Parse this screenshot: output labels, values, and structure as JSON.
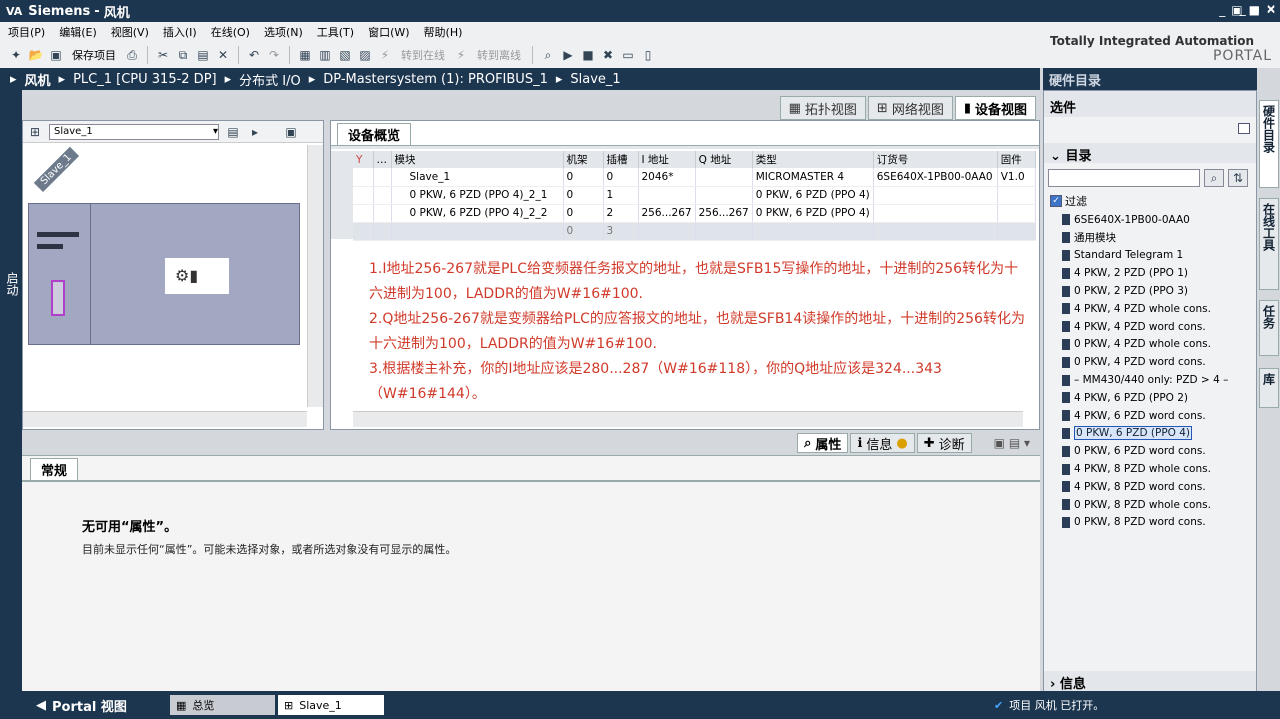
{
  "app": {
    "brand": "Siemens",
    "project": "风机"
  },
  "menu": [
    "项目(P)",
    "编辑(E)",
    "视图(V)",
    "插入(I)",
    "在线(O)",
    "选项(N)",
    "工具(T)",
    "窗口(W)",
    "帮助(H)"
  ],
  "toolbar": {
    "save": "保存项目",
    "go_online": "转到在线",
    "go_offline": "转到离线"
  },
  "tia": {
    "line1": "Totally Integrated Automation",
    "line2": "PORTAL"
  },
  "breadcrumb": [
    "风机",
    "PLC_1 [CPU 315-2 DP]",
    "分布式 I/O",
    "DP-Mastersystem (1): PROFIBUS_1",
    "Slave_1"
  ],
  "hw_catalog_title": "硬件目录",
  "left_strip_label": "启动",
  "view_tabs": [
    "拓扑视图",
    "网络视图",
    "设备视图"
  ],
  "device": {
    "selected": "Slave_1",
    "rack_label": "Slave_1"
  },
  "overview": {
    "tab": "设备概览",
    "columns": [
      "…",
      "模块",
      "机架",
      "插槽",
      "I 地址",
      "Q 地址",
      "类型",
      "订货号",
      "固件"
    ],
    "rows": [
      [
        "",
        "Slave_1",
        "0",
        "0",
        "2046*",
        "",
        "MICROMASTER 4",
        "6SE640X-1PB00-0AA0",
        "V1.0"
      ],
      [
        "",
        "0 PKW, 6 PZD (PPO 4)_2_1",
        "0",
        "1",
        "",
        "",
        "0 PKW, 6 PZD (PPO 4)",
        "",
        ""
      ],
      [
        "",
        "0 PKW, 6 PZD (PPO 4)_2_2",
        "0",
        "2",
        "256...267",
        "256...267",
        "0 PKW, 6 PZD (PPO 4)",
        "",
        ""
      ],
      [
        "",
        "",
        "0",
        "3",
        "",
        "",
        "",
        "",
        ""
      ]
    ]
  },
  "annotation": [
    "1.I地址256-267就是PLC给变频器任务报文的地址，也就是SFB15写操作的地址，十进制的256转化为十六进制为100，LADDR的值为W#16#100.",
    "2.Q地址256-267就是变频器给PLC的应答报文的地址，也就是SFB14读操作的地址，十进制的256转化为十六进制为100，LADDR的值为W#16#100.",
    "3.根据楼主补充，你的I地址应该是280...287（W#16#118），你的Q地址应该是324...343（W#16#144）。"
  ],
  "prop_tabs": [
    "属性",
    "信息",
    "诊断"
  ],
  "properties": {
    "tab": "常规",
    "title": "无可用“属性”。",
    "desc": "目前未显示任何“属性”。可能未选择对象，或者所选对象没有可显示的属性。"
  },
  "catalog": {
    "selection": "选件",
    "catalog_label": "目录",
    "filter": "过滤",
    "info": "信息",
    "items": [
      "6SE640X-1PB00-0AA0",
      "通用模块",
      "Standard Telegram 1",
      "4 PKW,  2 PZD  (PPO 1)",
      "0 PKW,  2 PZD  (PPO 3)",
      "4 PKW,  4 PZD whole cons.",
      "4 PKW,  4 PZD word cons.",
      "0 PKW,  4 PZD whole cons.",
      "0 PKW,  4 PZD word cons.",
      "– MM430/440 only: PZD > 4 –",
      "4 PKW,  6 PZD  (PPO 2)",
      "4 PKW,  6 PZD  word cons.",
      "0 PKW,  6 PZD  (PPO 4)",
      "0 PKW,  6 PZD  word cons.",
      "4 PKW,  8 PZD  whole cons.",
      "4 PKW,  8 PZD  word cons.",
      "0 PKW,  8 PZD  whole cons.",
      "0 PKW,  8 PZD  word cons."
    ],
    "selected_index": 12
  },
  "right_tabs": [
    "硬件目录",
    "在线工具",
    "任务",
    "库"
  ],
  "status": {
    "portal": "Portal 视图",
    "overview": "总览",
    "slave": "Slave_1",
    "msg": "项目 风机 已打开。"
  }
}
